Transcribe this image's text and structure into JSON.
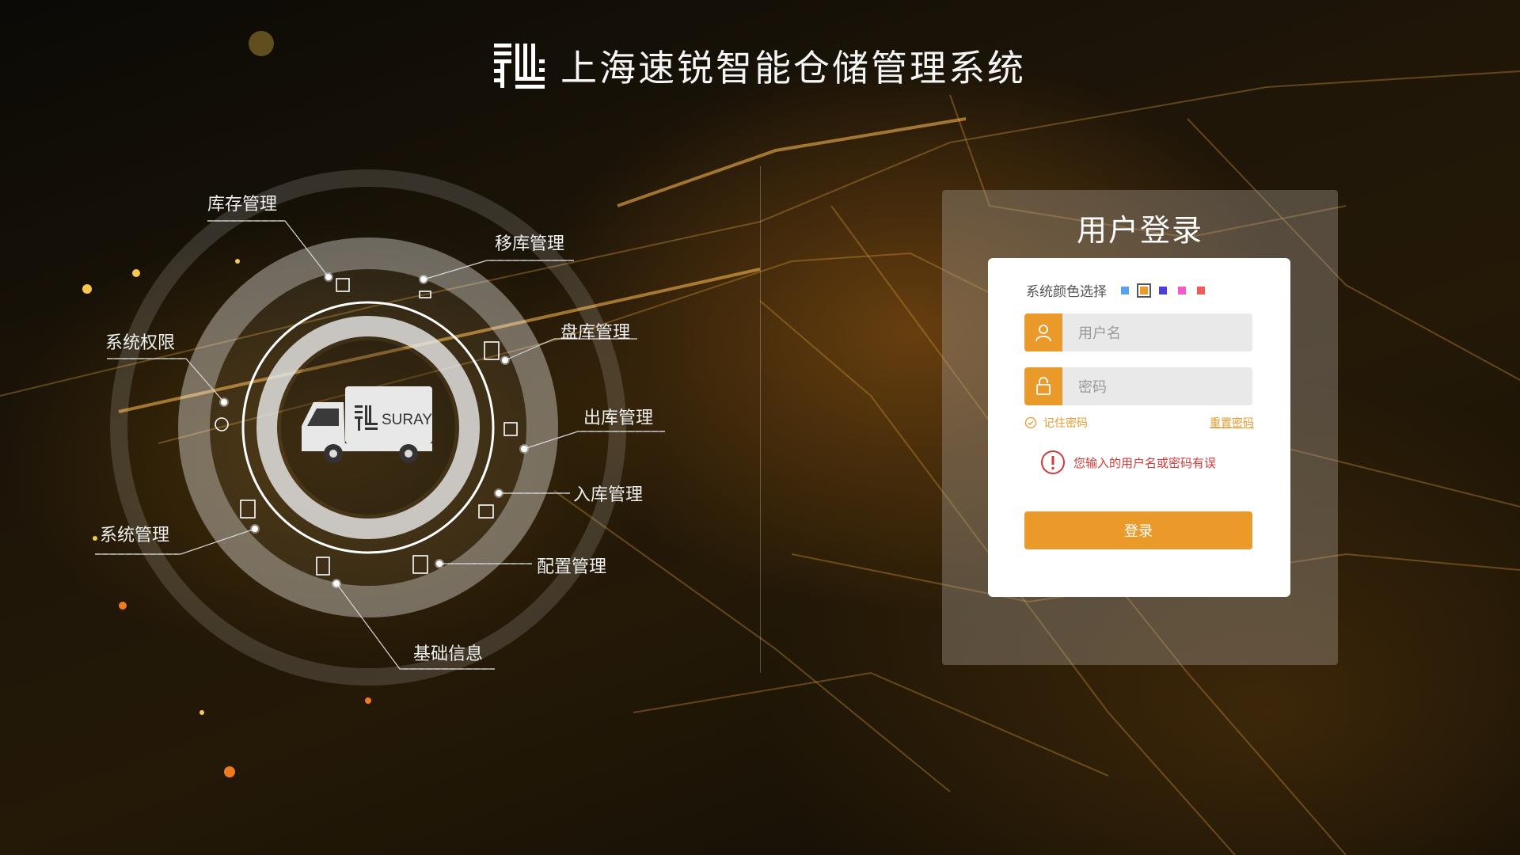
{
  "header": {
    "title": "上海速锐智能仓储管理系统"
  },
  "diagram": {
    "truck_brand": "SURAY",
    "modules": [
      "库存管理",
      "移库管理",
      "盘库管理",
      "出库管理",
      "入库管理",
      "配置管理",
      "基础信息",
      "系统管理",
      "系统权限"
    ]
  },
  "login": {
    "title": "用户登录",
    "color_label": "系统颜色选择",
    "colors": [
      "#5aa0f2",
      "#e99a2b",
      "#4b3fe0",
      "#f25ac8",
      "#f25a5a"
    ],
    "selected_color": "#e99a2b",
    "username_placeholder": "用户名",
    "password_placeholder": "密码",
    "remember_label": "记住密码",
    "reset_label": "重置密码",
    "error_message": "您输入的用户名或密码有误",
    "submit_label": "登录"
  }
}
